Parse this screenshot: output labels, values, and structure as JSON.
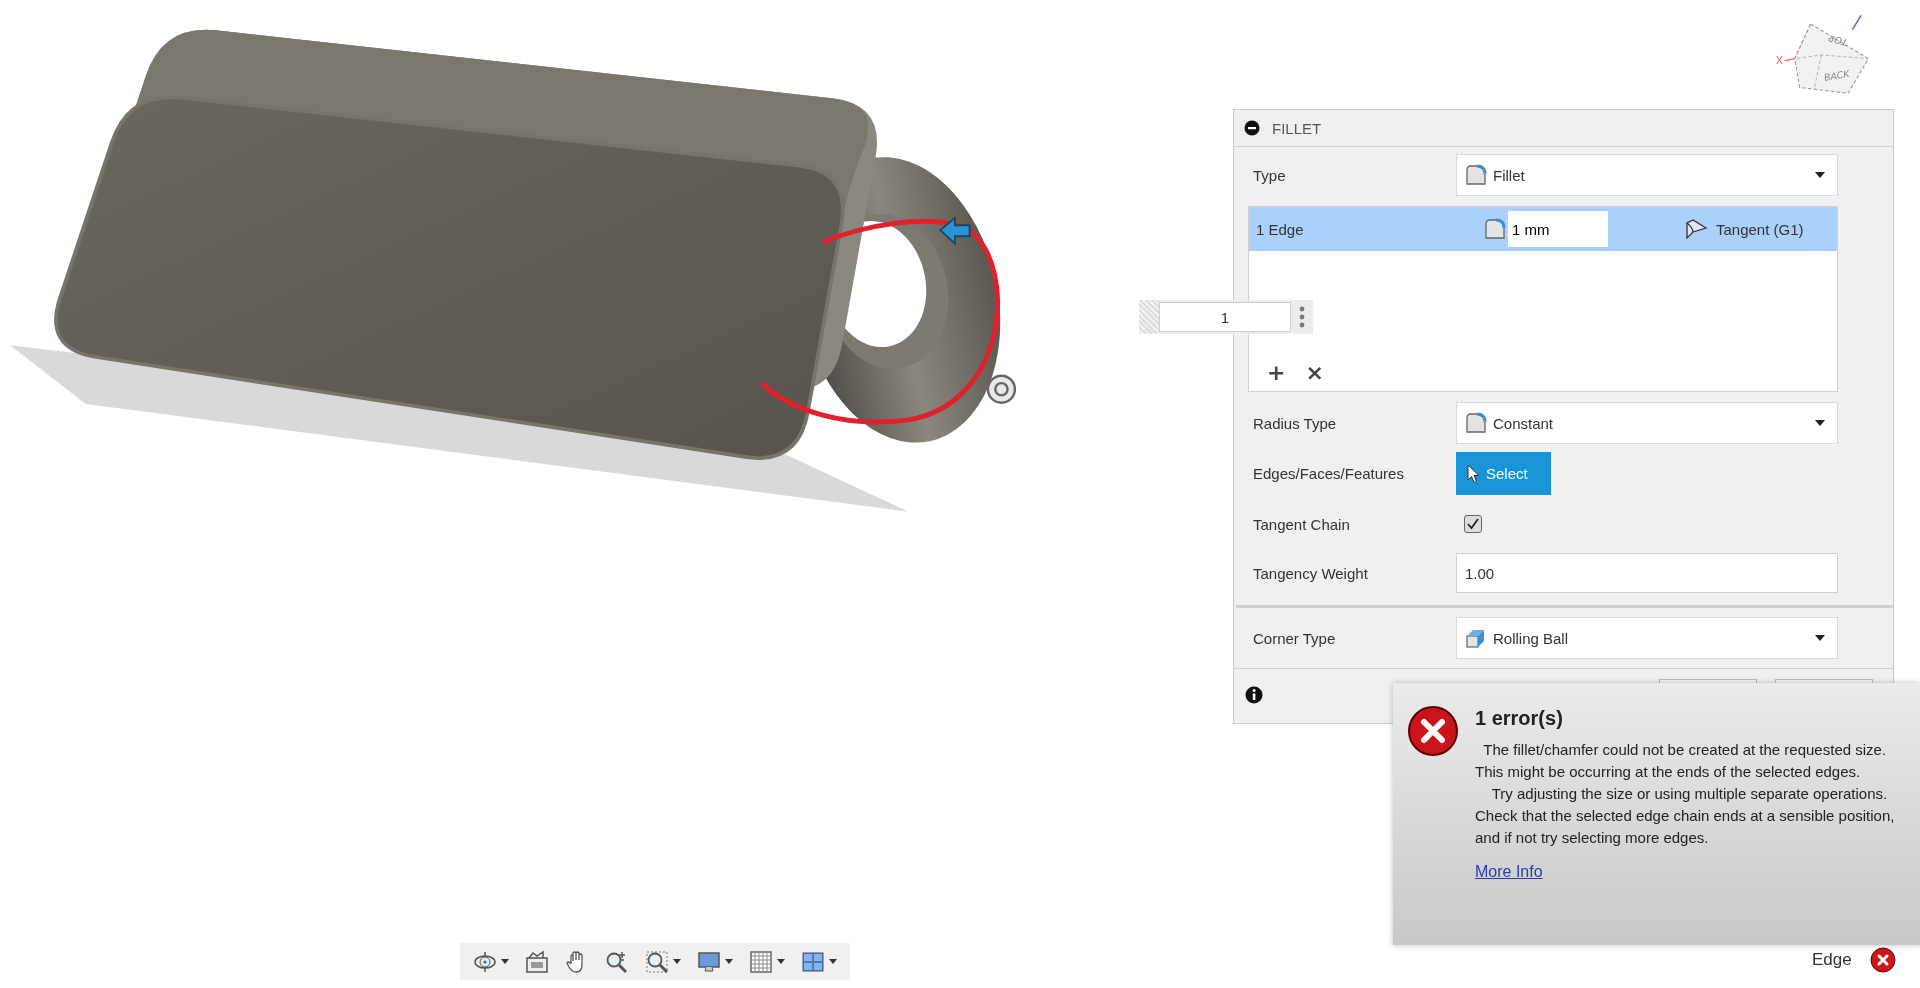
{
  "viewport": {
    "view_cube": {
      "labels": [
        "TOP",
        "BACK"
      ],
      "axis_label": "X"
    },
    "floating_input": {
      "value": "1"
    }
  },
  "fillet_panel": {
    "title": "FILLET",
    "groups": [
      {
        "rows": [
          {
            "kind": "dropdown",
            "label": "Type",
            "value": "Fillet"
          },
          {
            "kind": "edge_table",
            "rows": [
              {
                "edges": "1 Edge",
                "radius": "1 mm",
                "continuity": "Tangent (G1)",
                "selected": true
              }
            ],
            "actions": [
              "+",
              "×"
            ]
          },
          {
            "kind": "dropdown",
            "label": "Radius Type",
            "value": "Constant"
          },
          {
            "kind": "select",
            "label": "Edges/Faces/Features",
            "button": "Select"
          },
          {
            "kind": "checkbox",
            "label": "Tangent Chain",
            "checked": true
          },
          {
            "kind": "number",
            "label": "Tangency Weight",
            "value": "1.00"
          }
        ]
      },
      {
        "rows": [
          {
            "kind": "dropdown",
            "label": "Corner Type",
            "value": "Rolling Ball"
          }
        ]
      }
    ]
  },
  "error": {
    "title": "1 error(s)",
    "paragraphs": [
      "  The fillet/chamfer could not be created at the requested size. This might be occurring at the ends of the selected edges.",
      "    Try adjusting the size or using multiple separate operations. Check that the selected edge chain ends at a sensible position, and if not try selecting more edges."
    ],
    "link": "More Info"
  },
  "status": {
    "label": "Edge"
  },
  "toolbar": {
    "items": [
      {
        "kind": "orbit",
        "menu": true
      },
      {
        "kind": "look_at",
        "menu": false
      },
      {
        "kind": "pan",
        "menu": false
      },
      {
        "kind": "zoom",
        "menu": false
      },
      {
        "kind": "fit",
        "menu": true
      },
      {
        "kind": "display",
        "menu": true
      },
      {
        "kind": "grid",
        "menu": true
      },
      {
        "kind": "viewports",
        "menu": true
      }
    ]
  }
}
